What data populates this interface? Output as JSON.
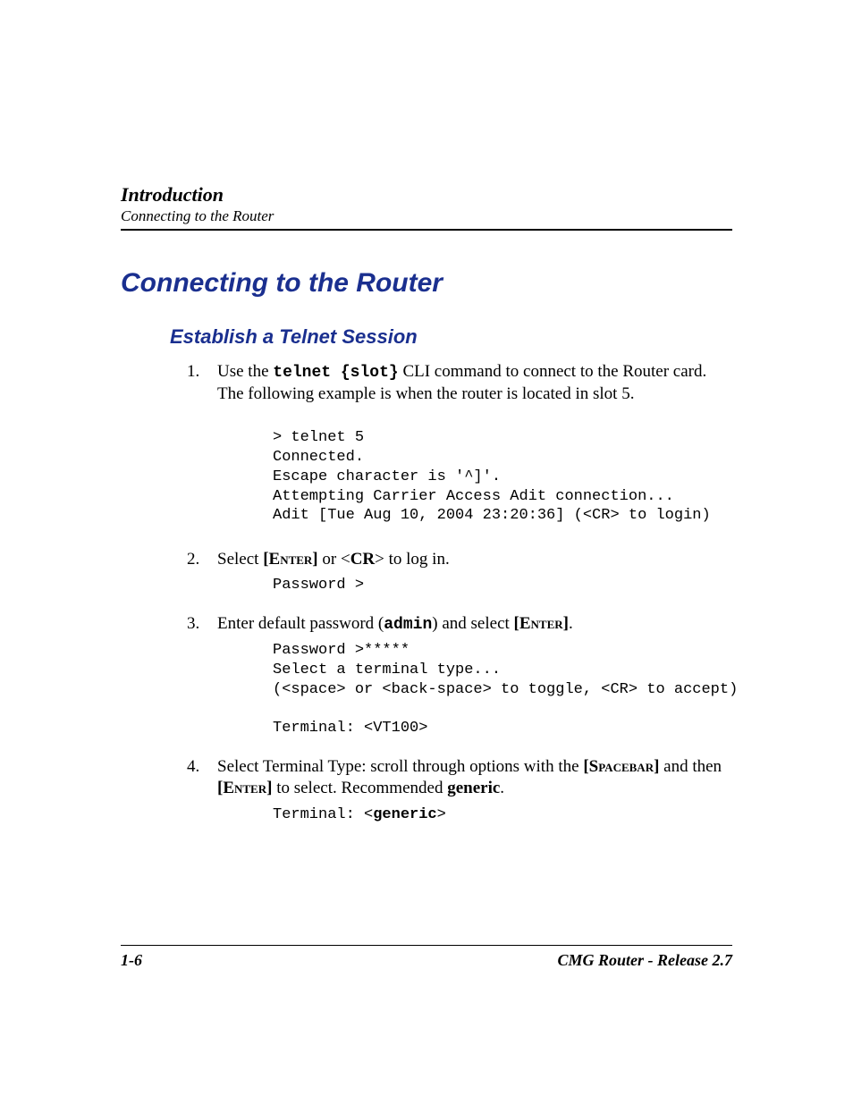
{
  "header": {
    "chapter": "Introduction",
    "section": "Connecting to the Router"
  },
  "h1": "Connecting to the Router",
  "h2": "Establish a Telnet Session",
  "steps": {
    "s1": {
      "num": "1.",
      "pre": "Use the ",
      "cmd": "telnet {slot}",
      "post": " CLI command to connect to the Router card. The following example is when the router is located in slot 5."
    },
    "term1": "> telnet 5\nConnected.\nEscape character is '^]'.\nAttempting Carrier Access Adit connection...\nAdit [Tue Aug 10, 2004 23:20:36] (<CR> to login)",
    "s2": {
      "num": "2.",
      "pre": "Select ",
      "key1": "[Enter]",
      "mid": " or <",
      "key2": "CR",
      "post": "> to log in."
    },
    "term2": "Password >",
    "s3": {
      "num": "3.",
      "pre": "Enter default password (",
      "pwd": "admin",
      "mid": ") and select ",
      "key": "[Enter]",
      "post": "."
    },
    "term3": "Password >*****\nSelect a terminal type...\n(<space> or <back-space> to toggle, <CR> to accept)\n\nTerminal: <VT100>",
    "s4": {
      "num": "4.",
      "pre": "Select Terminal Type: scroll through options with the ",
      "key1": "[Spacebar]",
      "mid": " and then ",
      "key2": "[Enter]",
      "post1": " to select. Recommended ",
      "rec": "generic",
      "post2": "."
    },
    "term4a": "Terminal: <",
    "term4b": "generic",
    "term4c": ">"
  },
  "footer": {
    "page": "1-6",
    "doc": "CMG Router - Release 2.7"
  }
}
